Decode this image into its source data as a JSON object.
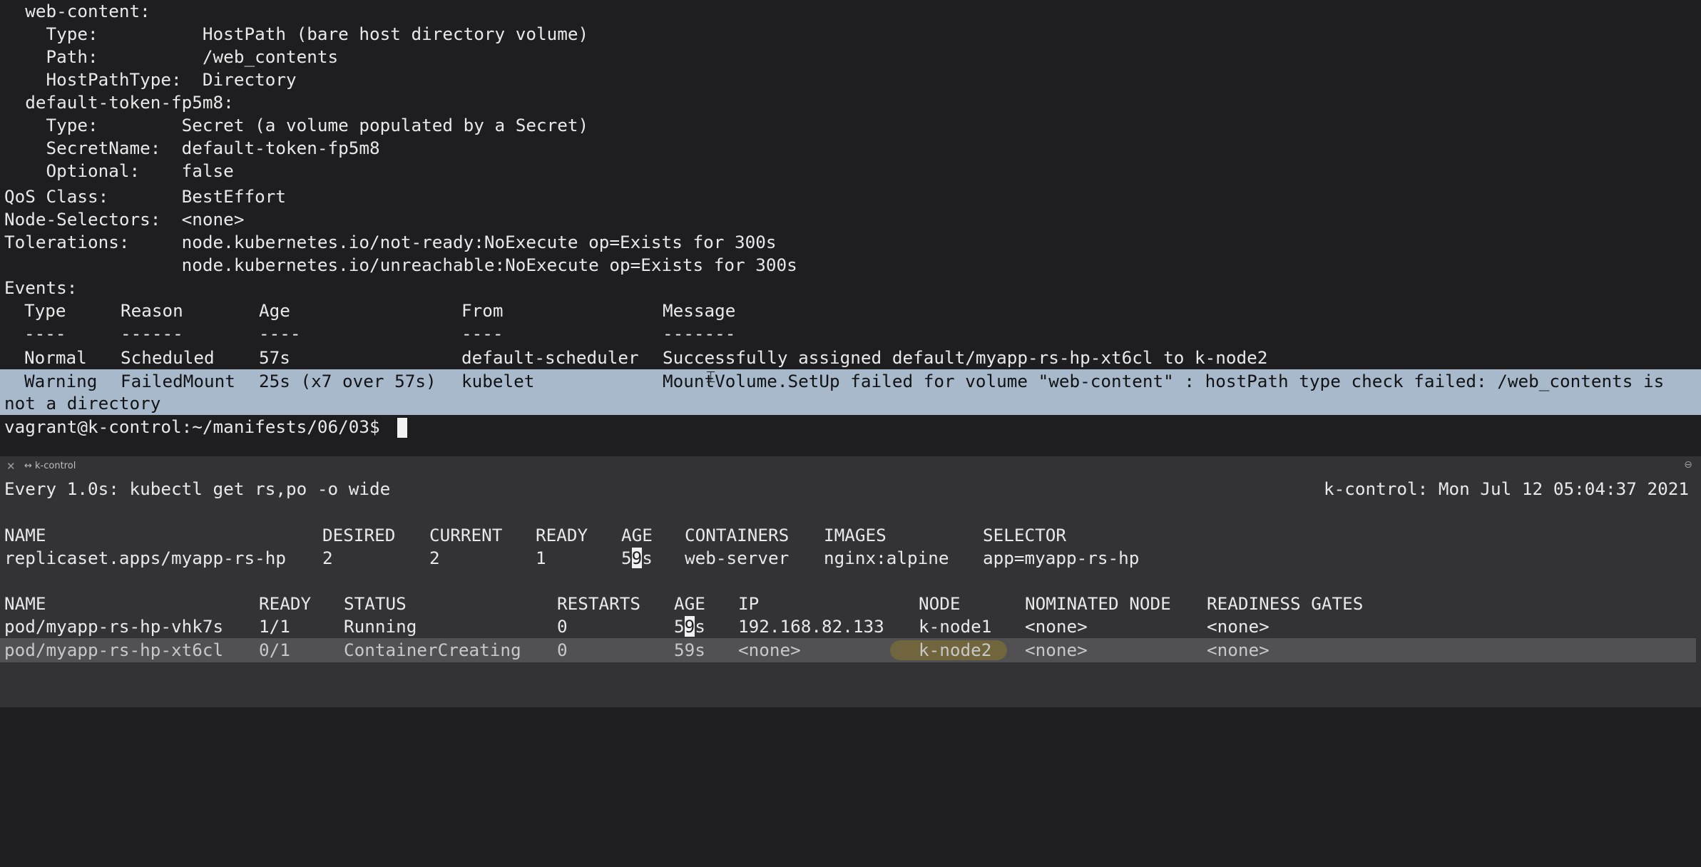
{
  "top_pane": {
    "lines": [
      "  web-content:",
      "    Type:          HostPath (bare host directory volume)",
      "    Path:          /web_contents",
      "    HostPathType:  Directory",
      "  default-token-fp5m8:",
      "    Type:        Secret (a volume populated by a Secret)",
      "    SecretName:  default-token-fp5m8",
      "    Optional:    false",
      "QoS Class:       BestEffort",
      "Node-Selectors:  <none>",
      "Tolerations:     node.kubernetes.io/not-ready:NoExecute op=Exists for 300s",
      "                 node.kubernetes.io/unreachable:NoExecute op=Exists for 300s",
      "Events:"
    ],
    "events": {
      "headers": [
        "Type",
        "Reason",
        "Age",
        "From",
        "Message"
      ],
      "dashes": [
        "----",
        "------",
        "----",
        "----",
        "-------"
      ],
      "rows": [
        {
          "type": "Normal",
          "reason": "Scheduled",
          "age": "57s",
          "from": "default-scheduler",
          "message": "Successfully assigned default/myapp-rs-hp-xt6cl to k-node2"
        },
        {
          "type": "Warning",
          "reason": "FailedMount",
          "age": "25s (x7 over 57s)",
          "from": "kubelet",
          "message": "MountVolume.SetUp failed for volume \"web-content\" : hostPath type check failed: /web_contents is",
          "message_wrap": "not a directory"
        }
      ]
    },
    "prompt": "vagrant@k-control:~/manifests/06/03$ "
  },
  "tab_bar": {
    "close_glyph": "✕",
    "title": "↔ k-control",
    "max_glyph": "⊖"
  },
  "bottom_pane": {
    "watch_header_left": "Every 1.0s: kubectl get rs,po -o wide",
    "watch_header_right": "k-control: Mon Jul 12 05:04:37 2021",
    "rs_table": {
      "headers": [
        "NAME",
        "DESIRED",
        "CURRENT",
        "READY",
        "AGE",
        "CONTAINERS",
        "IMAGES",
        "SELECTOR"
      ],
      "rows": [
        {
          "name": "replicaset.apps/myapp-rs-hp",
          "desired": "2",
          "current": "2",
          "ready": "1",
          "age_a": "5",
          "age_b": "9",
          "age_c": "s",
          "containers": "web-server",
          "images": "nginx:alpine",
          "selector": "app=myapp-rs-hp"
        }
      ]
    },
    "pod_table": {
      "headers": [
        "NAME",
        "READY",
        "STATUS",
        "RESTARTS",
        "AGE",
        "IP",
        "NODE",
        "NOMINATED NODE",
        "READINESS GATES"
      ],
      "rows": [
        {
          "name": "pod/myapp-rs-hp-vhk7s",
          "ready": "1/1",
          "status": "Running",
          "restarts": "0",
          "age_a": "5",
          "age_b": "9",
          "age_c": "s",
          "ip": "192.168.82.133",
          "node": "k-node1",
          "nominated": "<none>",
          "gates": "<none>"
        },
        {
          "name": "pod/myapp-rs-hp-xt6cl",
          "ready": "0/1",
          "status": "ContainerCreating",
          "restarts": "0",
          "age": "59s",
          "ip": "<none>",
          "node": "k-node2",
          "nominated": "<none>",
          "gates": "<none>"
        }
      ]
    }
  },
  "colors": {
    "selection": "#a7b9cb",
    "row_highlight": "#515154",
    "marker": "#75683a"
  }
}
